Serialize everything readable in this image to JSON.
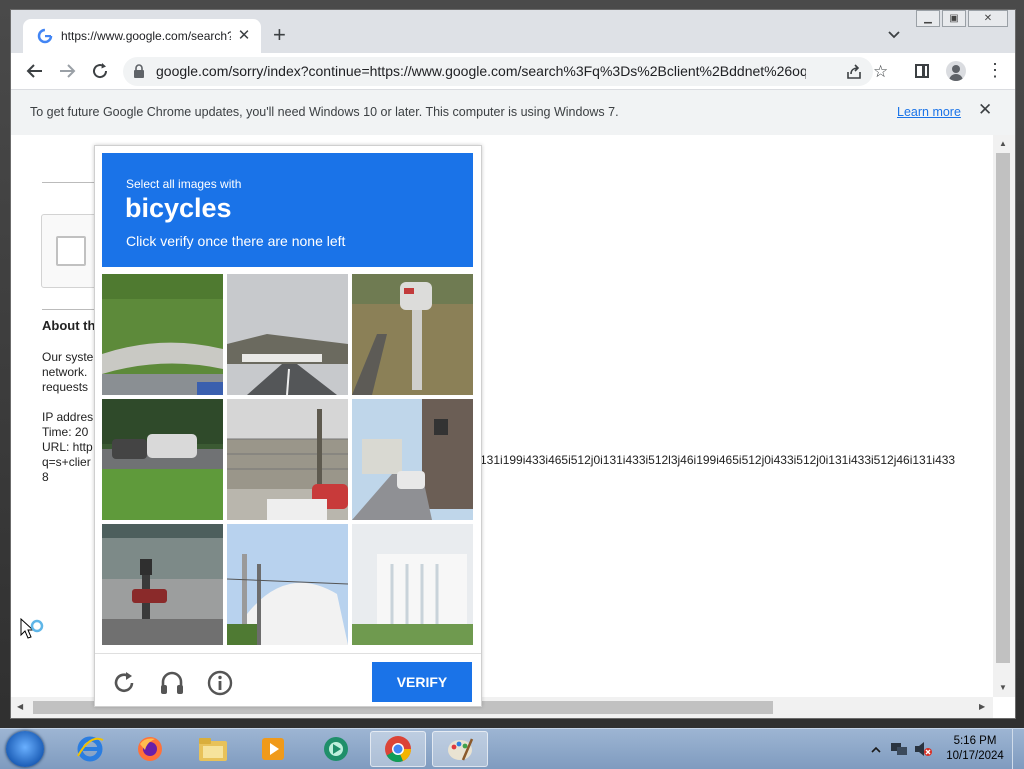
{
  "browser": {
    "tab_title": "https://www.google.com/search?",
    "url": "google.com/sorry/index?continue=https://www.google.com/search%3Fq%3Ds%2Bclient%2Bddnet%26oq%...",
    "new_tab_label": "+"
  },
  "infobar": {
    "message": "To get future Google Chrome updates, you'll need Windows 10 or later. This computer is using Windows 7.",
    "learn_more": "Learn more"
  },
  "page": {
    "about_heading": "About th",
    "para1": [
      "Our syste",
      "network.",
      "requests"
    ],
    "para2": [
      "IP addres",
      "Time: 20",
      "URL: http",
      "q=s+clier",
      "8"
    ],
    "long_line": "131i199i433i465i512j0i131i433i512l3j46i199i465i512j0i433i512j0i131i433i512j46i131i433"
  },
  "captcha": {
    "instruction_top": "Select all images with",
    "target": "bicycles",
    "instruction_bottom": "Click verify once there are none left",
    "verify_label": "VERIFY",
    "tiles": [
      {
        "name": "tile-grass-curb"
      },
      {
        "name": "tile-road-overpass"
      },
      {
        "name": "tile-mailbox"
      },
      {
        "name": "tile-parked-cars"
      },
      {
        "name": "tile-fence-car"
      },
      {
        "name": "tile-street-houses"
      },
      {
        "name": "tile-intersection"
      },
      {
        "name": "tile-building-pole"
      },
      {
        "name": "tile-white-building"
      }
    ]
  },
  "taskbar": {
    "time": "5:16 PM",
    "date": "10/17/2024",
    "items": [
      "internet-explorer",
      "firefox",
      "file-explorer",
      "media-player",
      "recorder-app",
      "chrome",
      "paint"
    ]
  },
  "colors": {
    "captcha_blue": "#1a73e8",
    "chrome_frame": "#dee1e6"
  }
}
